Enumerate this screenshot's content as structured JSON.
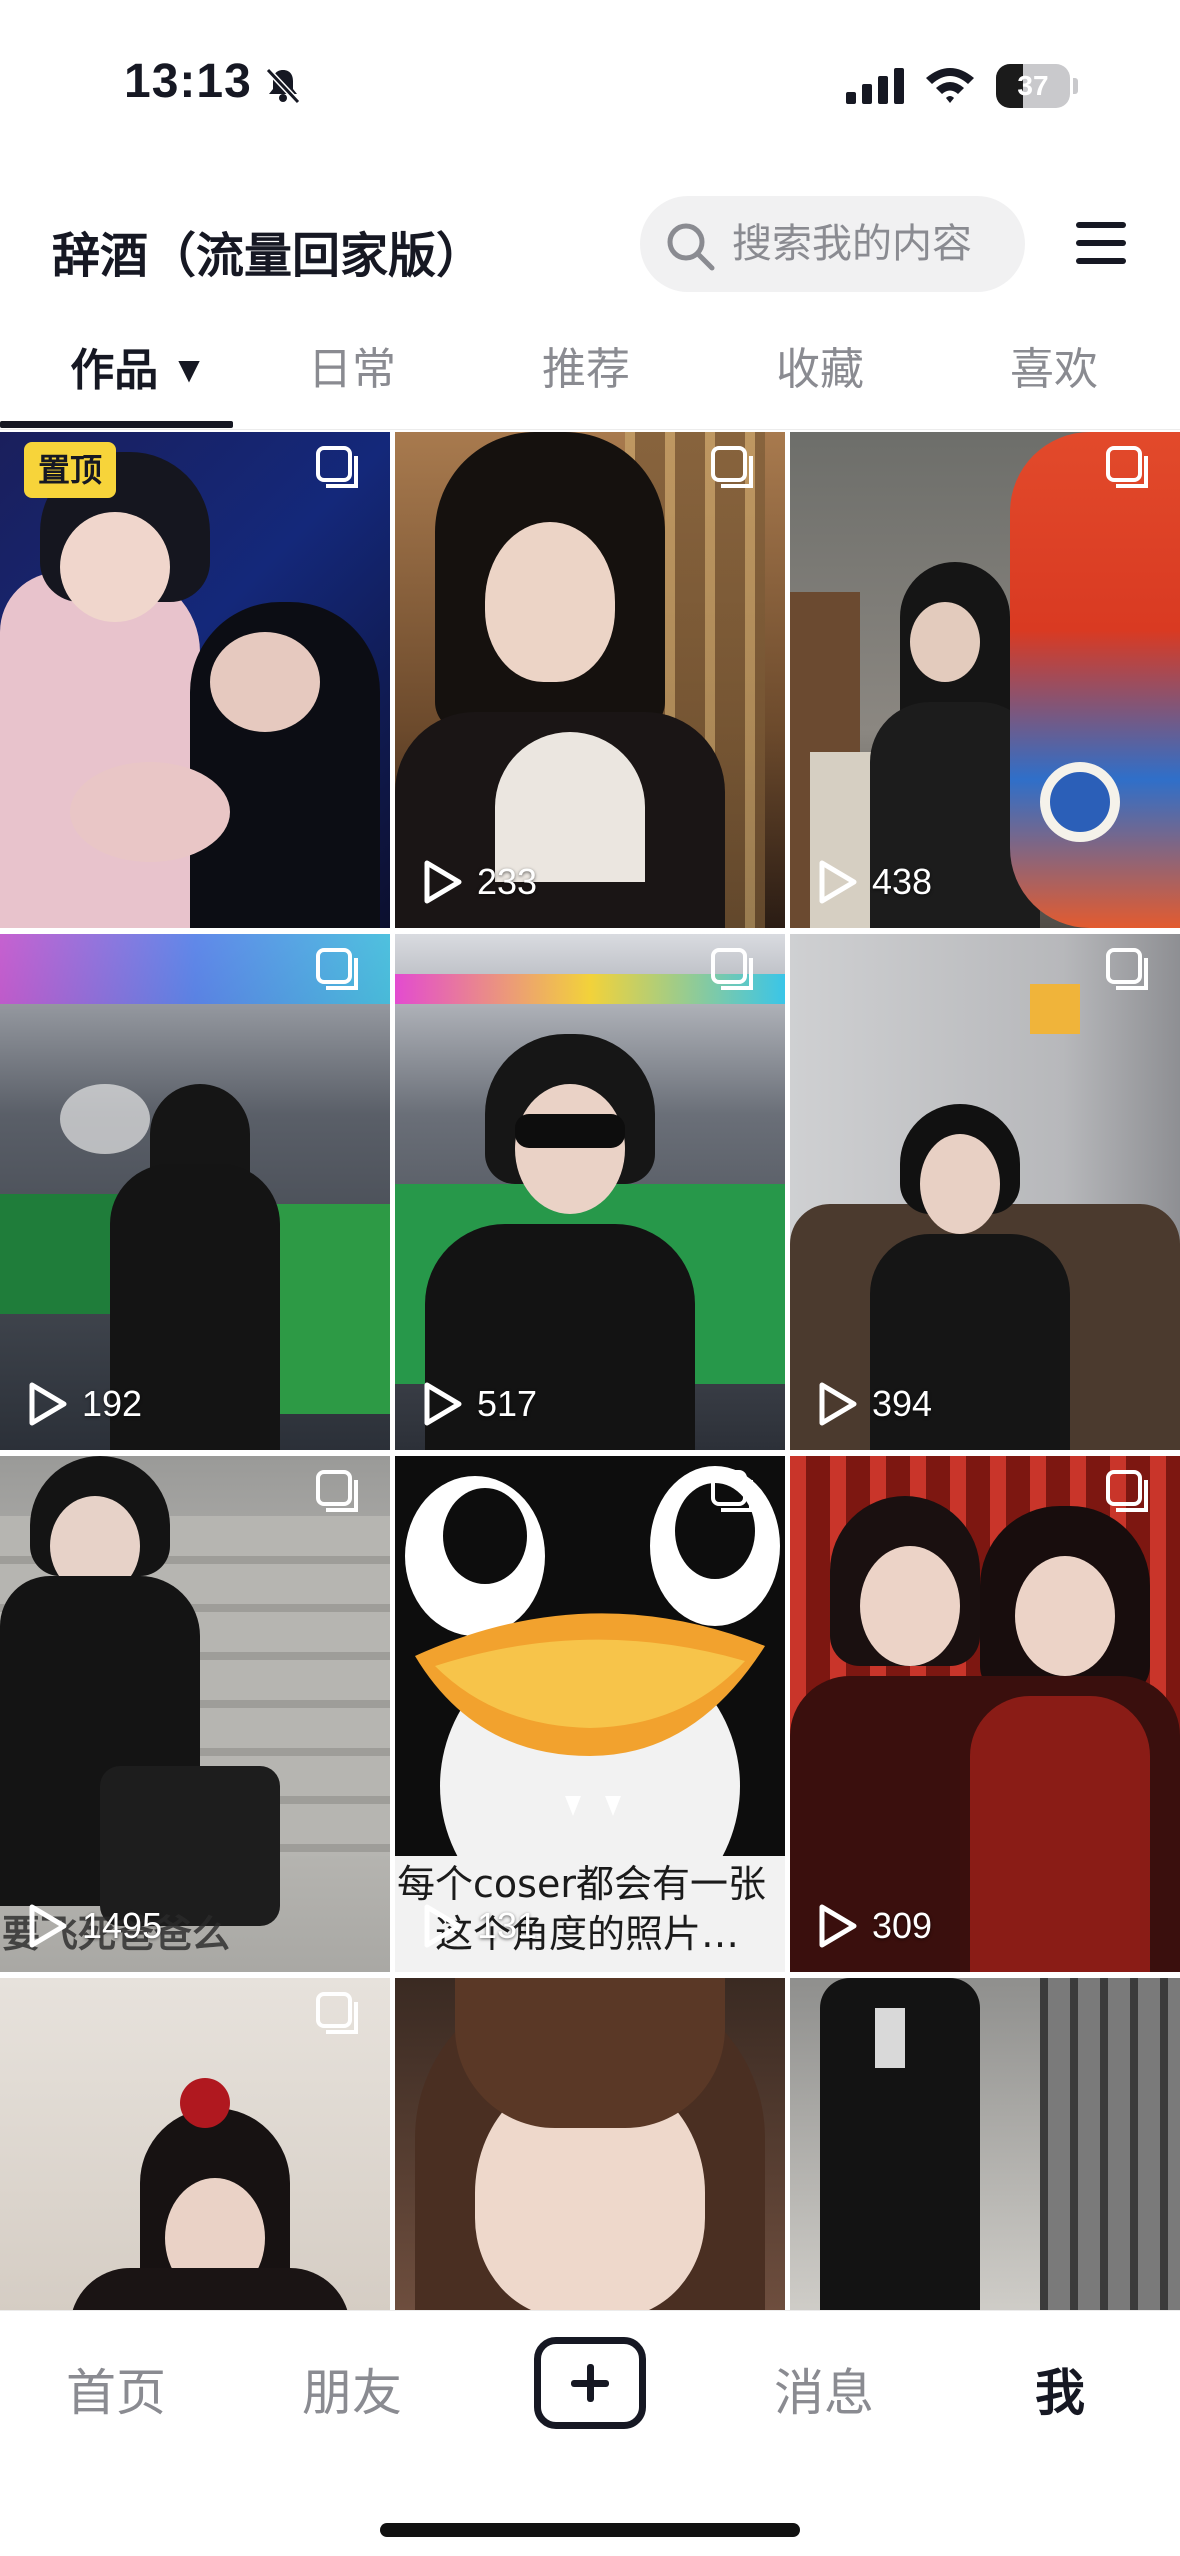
{
  "status_bar": {
    "time": "13:13",
    "battery": "37",
    "battery_level": 0.37
  },
  "header": {
    "title": "辞酒（流量回家版）",
    "search_placeholder": "搜索我的内容"
  },
  "tabs": [
    {
      "label": "作品",
      "active": true
    },
    {
      "label": "日常",
      "active": false
    },
    {
      "label": "推荐",
      "active": false
    },
    {
      "label": "收藏",
      "active": false
    },
    {
      "label": "喜欢",
      "active": false
    }
  ],
  "videos": [
    {
      "pinned": true,
      "pin_label": "置顶",
      "views": ""
    },
    {
      "views": "233"
    },
    {
      "views": "438"
    },
    {
      "views": "192"
    },
    {
      "views": "517"
    },
    {
      "views": "394"
    },
    {
      "views": "1495",
      "caption": "要飞死爸爸么"
    },
    {
      "views": "131",
      "caption_line1": "每个coser都会有一张",
      "caption_line2": "这个角度的照片…"
    },
    {
      "views": "309"
    },
    {
      "views": ""
    },
    {
      "views": ""
    },
    {
      "views": ""
    }
  ],
  "bottom_nav": [
    {
      "label": "首页"
    },
    {
      "label": "朋友"
    },
    {
      "label": "消息"
    },
    {
      "label": "我"
    }
  ],
  "colors": {
    "accent_pin": "#f7d43a",
    "text_primary": "#161823",
    "text_secondary": "#8a8b91"
  }
}
